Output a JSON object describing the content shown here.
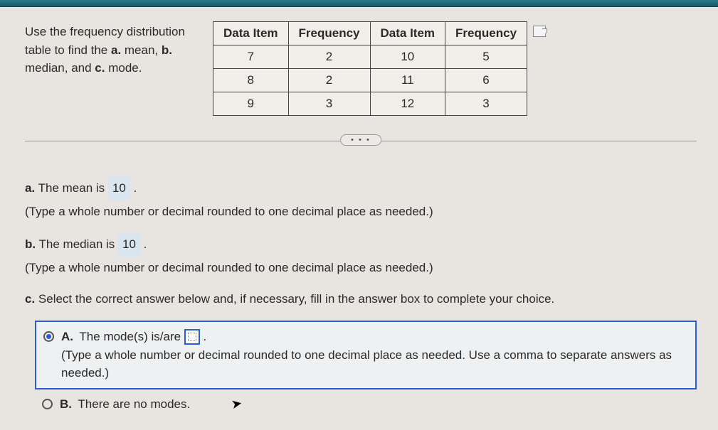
{
  "prompt": {
    "line1": "Use the frequency distribution table to find the ",
    "bold_a": "a.",
    "mid_a": " mean, ",
    "bold_b": "b.",
    "mid_b": " median, and ",
    "bold_c": "c.",
    "end": " mode."
  },
  "table": {
    "headers": [
      "Data Item",
      "Frequency",
      "Data Item",
      "Frequency"
    ],
    "rows": [
      [
        "7",
        "2",
        "10",
        "5"
      ],
      [
        "8",
        "2",
        "11",
        "6"
      ],
      [
        "9",
        "3",
        "12",
        "3"
      ]
    ]
  },
  "dots": "• • •",
  "partA": {
    "prefix": "a.",
    "text1": " The mean is ",
    "value": "10",
    "text2": " .",
    "hint": "(Type a whole number or decimal rounded to one decimal place as needed.)"
  },
  "partB": {
    "prefix": "b.",
    "text1": " The median is ",
    "value": "10",
    "text2": " .",
    "hint": "(Type a whole number or decimal rounded to one decimal place as needed.)"
  },
  "partC": {
    "prefix": "c.",
    "text": " Select the correct answer below and, if necessary, fill in the answer box to complete your choice."
  },
  "choiceA": {
    "label": "A.",
    "text1": "The mode(s) is/are ",
    "text2": ".",
    "hint": "(Type a whole number or decimal rounded to one decimal place as needed. Use a comma to separate answers as needed.)"
  },
  "choiceB": {
    "label": "B.",
    "text": "There are no modes."
  }
}
